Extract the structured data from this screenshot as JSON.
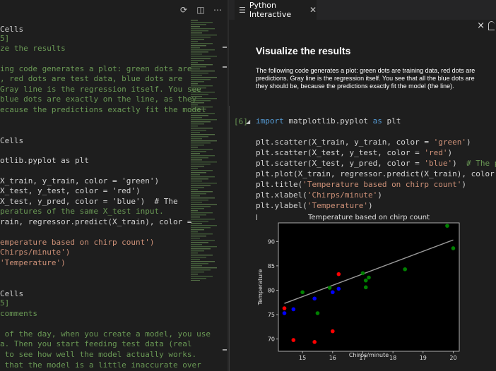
{
  "editor": {
    "lines": [
      {
        "t": "Cells",
        "c": "#cccccc",
        "top": 34
      },
      {
        "t": "5]",
        "c": "#6a9955",
        "top": 47
      },
      {
        "t": "ze the results",
        "c": "#6a9955",
        "top": 61
      },
      {
        "t": "ing code generates a plot: green dots are",
        "c": "#6a9955",
        "top": 90
      },
      {
        "t": ", red dots are test data, blue dots are",
        "c": "#6a9955",
        "top": 104
      },
      {
        "t": "Gray line is the regression itself. You see",
        "c": "#6a9955",
        "top": 119
      },
      {
        "t": "blue dots are exactly on the line, as they",
        "c": "#6a9955",
        "top": 133
      },
      {
        "t": "ecause the predictions exactly fit the model",
        "c": "#6a9955",
        "top": 148
      },
      {
        "t": "Cells",
        "c": "#cccccc",
        "top": 192
      },
      {
        "t": "otlib.pyplot as plt",
        "c": "#d4d4d4",
        "top": 220
      },
      {
        "t": "X_train, y_train, color = 'green')",
        "c": "#d4d4d4",
        "top": 249
      },
      {
        "t": "X_test, y_test, color = 'red')",
        "c": "#d4d4d4",
        "top": 263
      },
      {
        "t": "X_test, y_pred, color = 'blue')  # The",
        "c": "#d4d4d4",
        "top": 278
      },
      {
        "t": "peratures of the same X_test input.",
        "c": "#6a9955",
        "top": 292
      },
      {
        "t": "rain, regressor.predict(X_train), color =",
        "c": "#d4d4d4",
        "top": 307
      },
      {
        "t": "emperature based on chirp count')",
        "c": "#ce9178",
        "top": 336
      },
      {
        "t": "Chirps/minute')",
        "c": "#ce9178",
        "top": 350
      },
      {
        "t": "'Temperature')",
        "c": "#ce9178",
        "top": 365
      },
      {
        "t": "Cells",
        "c": "#cccccc",
        "top": 409
      },
      {
        "t": "5]",
        "c": "#6a9955",
        "top": 422
      },
      {
        "t": "comments",
        "c": "#6a9955",
        "top": 437
      },
      {
        "t": " of the day, when you create a model, you use",
        "c": "#6a9955",
        "top": 466
      },
      {
        "t": "a. Then you start feeding test data (real",
        "c": "#6a9955",
        "top": 480
      },
      {
        "t": " to see how well the model actually works.",
        "c": "#6a9955",
        "top": 495
      },
      {
        "t": " that the model is a little inaccurate over",
        "c": "#6a9955",
        "top": 510
      }
    ]
  },
  "panel": {
    "tab_label": "Python Interactive",
    "close_glyph": "×",
    "markdown_title": "Visualize the results",
    "markdown_lines": [
      "The following code generates a plot: green dots are training data, red dots are",
      "predictions. Gray line is the regression itself. You see that all the blue dots are",
      "they should be, because the predictions exactly fit the model (the line)."
    ],
    "exec_count": "[6]"
  },
  "colors": {
    "accent_green": "#6a9955",
    "keyword": "#569cd6",
    "string": "#ce9178"
  },
  "chart_data": {
    "type": "scatter",
    "title": "Temperature based on chirp count",
    "xlabel": "Chirps/minute",
    "ylabel": "Temperature",
    "xlim": [
      14.2,
      20.2
    ],
    "ylim": [
      67.5,
      93.8
    ],
    "xticks": [
      15,
      16,
      17,
      18,
      19,
      20
    ],
    "yticks": [
      70,
      75,
      80,
      85,
      90
    ],
    "background": "#000000",
    "series": [
      {
        "name": "",
        "color": "green",
        "points": [
          [
            15.0,
            79.6
          ],
          [
            15.5,
            75.3
          ],
          [
            15.9,
            80.5
          ],
          [
            17.0,
            83.5
          ],
          [
            17.1,
            82.0
          ],
          [
            17.1,
            80.6
          ],
          [
            17.2,
            82.6
          ],
          [
            18.4,
            84.3
          ],
          [
            19.8,
            93.2
          ],
          [
            20.0,
            88.6
          ]
        ]
      },
      {
        "name": "",
        "color": "red",
        "points": [
          [
            14.4,
            76.3
          ],
          [
            14.7,
            69.8
          ],
          [
            15.4,
            69.4
          ],
          [
            16.0,
            71.6
          ],
          [
            16.2,
            83.3
          ]
        ]
      },
      {
        "name": "",
        "color": "blue",
        "points": [
          [
            14.4,
            75.3
          ],
          [
            14.7,
            76.1
          ],
          [
            15.4,
            78.3
          ],
          [
            16.0,
            79.6
          ],
          [
            16.2,
            80.3
          ]
        ]
      }
    ],
    "line": {
      "color": "gray",
      "points": [
        [
          14.4,
          77.3
        ],
        [
          20.0,
          90.3
        ]
      ]
    }
  }
}
